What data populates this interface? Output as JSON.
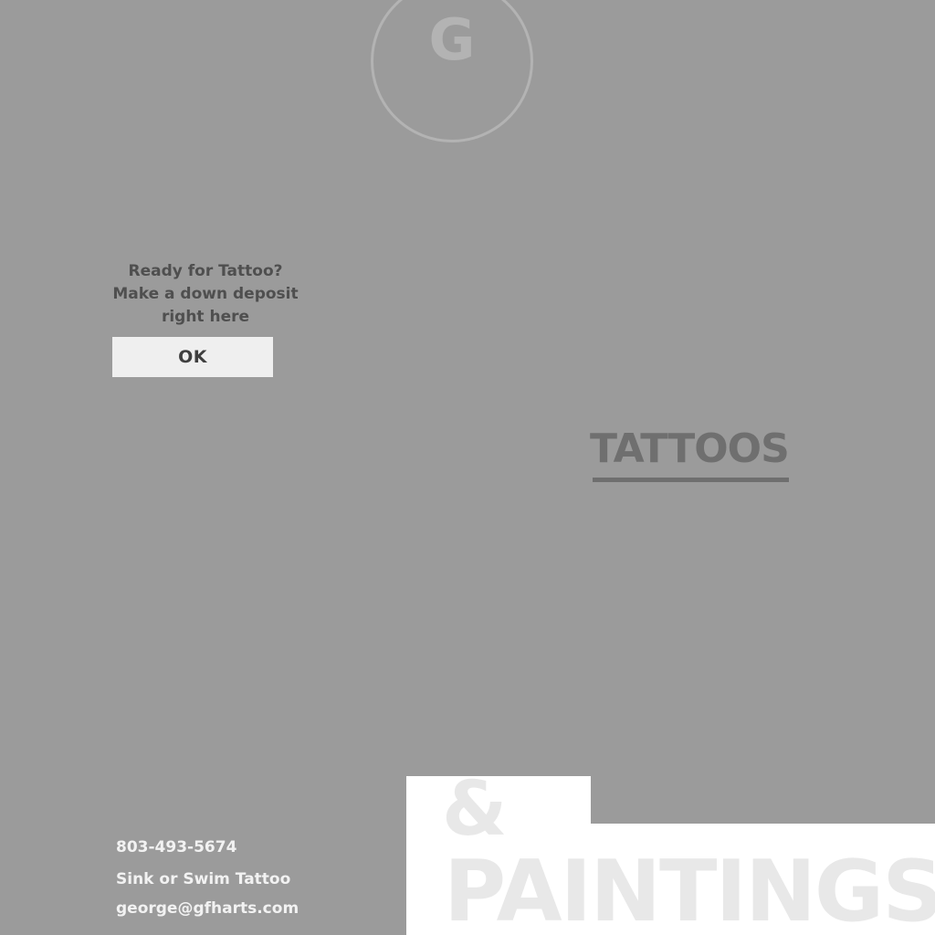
{
  "logo": {
    "letter": "G"
  },
  "promo": {
    "lines": [
      "Ready for Tattoo?",
      "Make a down deposit",
      "right here"
    ],
    "button_label": "OK"
  },
  "nav": {
    "tattoos_label": "TATTOOS"
  },
  "feature": {
    "ampersand": "&",
    "paintings": "PAINTINGS"
  },
  "contact": {
    "phone": "803-493-5674",
    "studio": "Sink or Swim Tattoo",
    "email": "george@gfharts.com"
  },
  "colors": {
    "background": "#9b9b9b",
    "panel": "#ffffff",
    "button_bg": "#efefef",
    "link": "#6f6f6f",
    "contact_text": "#f2f2f2"
  }
}
